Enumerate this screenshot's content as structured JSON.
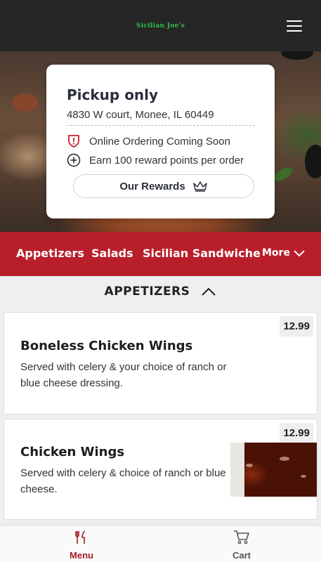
{
  "header": {
    "brand": "Sicilian Joe's",
    "menu_icon": "hamburger-menu-icon"
  },
  "store_card": {
    "title": "Pickup only",
    "address": "4830 W court, Monee, IL 60449",
    "notice": "Online Ordering Coming Soon",
    "notice_icon": "alert-shield-icon",
    "reward_info": "Earn 100 reward points per order",
    "reward_icon": "plus-circle-icon",
    "rewards_button": "Our Rewards",
    "rewards_button_icon": "crown-icon"
  },
  "categories": {
    "items": [
      "Appetizers",
      "Salads",
      "Sicilian Sandwiche"
    ],
    "more_label": "More",
    "accent": "#b81f2b"
  },
  "section": {
    "title": "APPETIZERS",
    "toggle_icon": "chevron-up-icon"
  },
  "menu_items": [
    {
      "name": "Boneless Chicken Wings",
      "description": "Served with celery & your choice of ranch or blue cheese dressing.",
      "price": "12.99"
    },
    {
      "name": "Chicken Wings",
      "description": "Served with celery & choice of ranch or blue cheese.",
      "price": "12.99",
      "image": "chicken-wings-photo"
    }
  ],
  "bottom_nav": [
    {
      "label": "Menu",
      "icon": "fork-knife-icon",
      "active": true,
      "color": "#a61c26"
    },
    {
      "label": "Cart",
      "icon": "cart-icon",
      "active": false,
      "color": "#555555"
    }
  ]
}
